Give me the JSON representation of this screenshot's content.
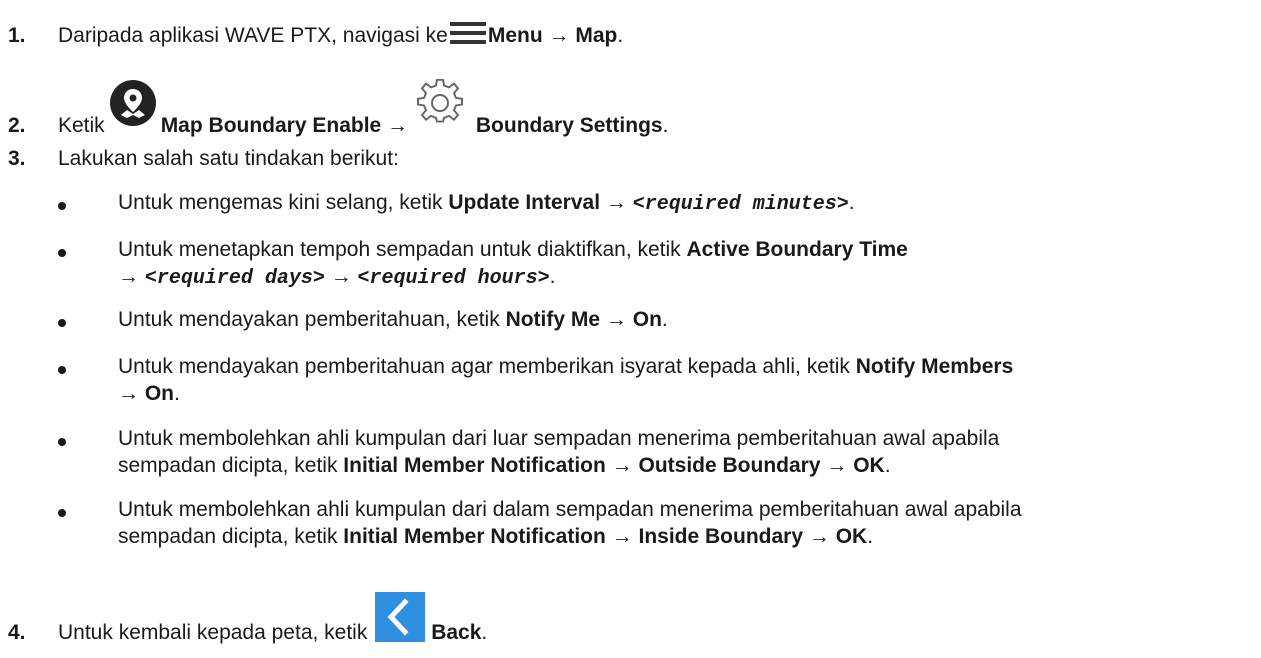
{
  "steps": [
    {
      "num": "1.",
      "parts": [
        "Daripada aplikasi WAVE PTX, navigasi ke ",
        "Menu",
        " → ",
        "Map",
        "."
      ]
    },
    {
      "num": "2.",
      "parts": [
        "Ketik ",
        "Map Boundary Enable",
        " → ",
        "Boundary Settings",
        "."
      ]
    },
    {
      "num": "3.",
      "parts": [
        "Lakukan salah satu tindakan berikut:"
      ]
    },
    {
      "num": "4.",
      "parts": [
        "Untuk kembali kepada peta, ketik ",
        "Back",
        "."
      ]
    }
  ],
  "bullets": [
    {
      "parts": [
        "Untuk mengemas kini selang, ketik ",
        "Update Interval",
        " → ",
        "<required minutes>",
        "."
      ]
    },
    {
      "parts": [
        "Untuk menetapkan tempoh sempadan untuk diaktifkan, ketik ",
        "Active Boundary Time",
        "→ ",
        "<required days>",
        " → ",
        "<required hours>",
        "."
      ]
    },
    {
      "parts": [
        "Untuk mendayakan pemberitahuan, ketik ",
        "Notify Me",
        " → ",
        "On",
        "."
      ]
    },
    {
      "parts": [
        "Untuk mendayakan pemberitahuan agar memberikan isyarat kepada ahli, ketik ",
        "Notify Members",
        "→ ",
        "On",
        "."
      ]
    },
    {
      "parts": [
        "Untuk membolehkan ahli kumpulan dari luar sempadan menerima pemberitahuan awal apabila",
        "sempadan dicipta, ketik ",
        "Initial Member Notification",
        " → ",
        "Outside Boundary",
        " → ",
        "OK",
        "."
      ]
    },
    {
      "parts": [
        "Untuk membolehkan ahli kumpulan dari dalam sempadan menerima pemberitahuan awal apabila",
        "sempadan dicipta, ketik ",
        "Initial Member Notification",
        " → ",
        "Inside Boundary",
        " → ",
        "OK",
        "."
      ]
    }
  ],
  "icons": {
    "menu": "hamburger-menu-icon",
    "map_boundary": "map-pin-icon",
    "settings": "gear-icon",
    "back": "back-chevron-icon"
  },
  "colors": {
    "back_icon_bg": "#2f8fe0",
    "text": "#1a1a1a"
  }
}
